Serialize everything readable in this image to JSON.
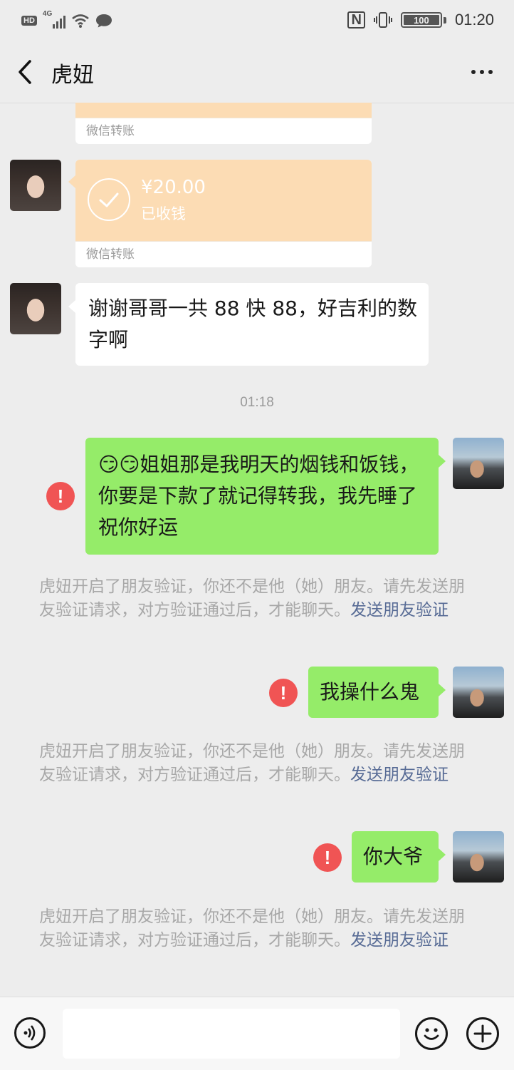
{
  "status_bar": {
    "hd": "HD",
    "network": "4G",
    "nfc": "N",
    "battery": "100",
    "time": "01:20"
  },
  "header": {
    "title": "虎妞",
    "back_icon": "chevron-left-icon",
    "more_icon": "more-dots-icon"
  },
  "messages": {
    "transfer_1": {
      "footer": "微信转账"
    },
    "transfer_2": {
      "amount": "¥20.00",
      "status": "已收钱",
      "footer": "微信转账"
    },
    "text_in_1": "谢谢哥哥一共 88 快 88，好吉利的数字啊",
    "timestamp": "01:18",
    "text_out_1": "姐姐那是我明天的烟钱和饭钱，你要是下款了就记得转我，我先睡了祝你好运",
    "text_out_1_emoji": "😏😏",
    "text_out_2": "我操什么鬼",
    "text_out_3": "你大爷",
    "error_mark": "!",
    "system_notice": "虎妞开启了朋友验证，你还不是他（她）朋友。请先发送朋友验证请求，对方验证通过后，才能聊天。",
    "system_link": "发送朋友验证"
  },
  "input_bar": {
    "voice_icon": "voice-icon",
    "emoji_icon": "emoji-icon",
    "plus_icon": "plus-icon",
    "text": ""
  },
  "colors": {
    "background": "#ededed",
    "bubble_green": "#95ec69",
    "transfer_orange": "#fcdcb4",
    "error_red": "#f05454",
    "link_blue": "#576b95"
  }
}
